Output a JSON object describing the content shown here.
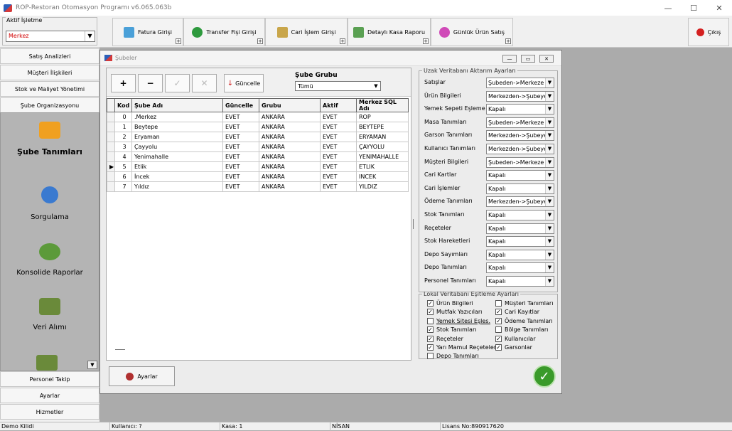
{
  "app": {
    "title": "ROP-Restoran Otomasyon Programı v6.065.063b"
  },
  "colors": {
    "selected_text": "#d00000",
    "accent_green": "#3a9a2a"
  },
  "business": {
    "label": "Aktif İşletme",
    "value": "Merkez"
  },
  "toolbar": [
    {
      "label": "Fatura Girişi",
      "icon": "invoice-icon"
    },
    {
      "label": "Transfer Fişi Girişi",
      "icon": "transfer-icon"
    },
    {
      "label": "Cari İşlem Girişi",
      "icon": "account-transaction-icon"
    },
    {
      "label": "Detaylı Kasa Raporu",
      "icon": "cash-report-icon"
    },
    {
      "label": "Günlük Ürün Satış",
      "icon": "daily-sales-icon"
    }
  ],
  "exit_label": "Çıkış",
  "nav": {
    "top": [
      "Satış Analizleri",
      "Müşteri İlişkileri",
      "Stok ve Maliyet Yönetimi",
      "Şube Organizasyonu"
    ],
    "panel": [
      {
        "label": "Şube Tanımları",
        "icon": "branch-icon"
      },
      {
        "label": "Sorgulama",
        "icon": "globe-query-icon"
      },
      {
        "label": "Konsolide Raporlar",
        "icon": "report-icon"
      },
      {
        "label": "Veri Alımı",
        "icon": "data-import-icon"
      }
    ],
    "bottom": [
      "Personel Takip",
      "Ayarlar",
      "Hizmetler"
    ]
  },
  "window": {
    "title": "Şubeler"
  },
  "grid_toolbar": {
    "update_label": "Güncelle",
    "group_label": "Şube Grubu",
    "group_value": "Tümü"
  },
  "grid": {
    "columns": [
      "",
      "Kod",
      "Şube Adı",
      "Güncelle",
      "Grubu",
      "Aktif",
      "Merkez SQL Adı"
    ],
    "rows": [
      [
        "",
        "0",
        ".Merkez",
        "EVET",
        "ANKARA",
        "EVET",
        "ROP"
      ],
      [
        "",
        "1",
        "Beytepe",
        "EVET",
        "ANKARA",
        "EVET",
        "BEYTEPE"
      ],
      [
        "",
        "2",
        "Eryaman",
        "EVET",
        "ANKARA",
        "EVET",
        "ERYAMAN"
      ],
      [
        "",
        "3",
        "Çayyolu",
        "EVET",
        "ANKARA",
        "EVET",
        "ÇAYYOLU"
      ],
      [
        "",
        "4",
        "Yenimahalle",
        "EVET",
        "ANKARA",
        "EVET",
        "YENIMAHALLE"
      ],
      [
        "▶",
        "5",
        "Etlik",
        "EVET",
        "ANKARA",
        "EVET",
        "ETLIK"
      ],
      [
        "",
        "6",
        "İncek",
        "EVET",
        "ANKARA",
        "EVET",
        "INCEK"
      ],
      [
        "",
        "7",
        "Yıldız",
        "EVET",
        "ANKARA",
        "EVET",
        "YILDIZ"
      ]
    ]
  },
  "remote": {
    "legend": "Uzak Veritabanı Aktarım Ayarları",
    "rows": [
      {
        "label": "Satışlar",
        "value": "Şubeden->Merkeze"
      },
      {
        "label": "Ürün Bilgileri",
        "value": "Merkezden->Şubeye"
      },
      {
        "label": "Yemek Sepeti Eşleme",
        "value": "Kapalı"
      },
      {
        "label": "Masa Tanımları",
        "value": "Şubeden->Merkeze"
      },
      {
        "label": "Garson Tanımları",
        "value": "Merkezden->Şubeye"
      },
      {
        "label": "Kullanıcı Tanımları",
        "value": "Merkezden->Şubeye"
      },
      {
        "label": "Müşteri Bilgileri",
        "value": "Şubeden->Merkeze"
      },
      {
        "label": "Cari Kartlar",
        "value": "Kapalı"
      },
      {
        "label": "Cari İşlemler",
        "value": "Kapalı"
      },
      {
        "label": "Ödeme Tanımları",
        "value": "Merkezden->Şubeye"
      },
      {
        "label": "Stok Tanımları",
        "value": "Kapalı"
      },
      {
        "label": "Reçeteler",
        "value": "Kapalı"
      },
      {
        "label": "Stok Hareketleri",
        "value": "Kapalı"
      },
      {
        "label": "Depo Sayımları",
        "value": "Kapalı"
      },
      {
        "label": "Depo Tanımları",
        "value": "Kapalı"
      },
      {
        "label": "Personel Tanımları",
        "value": "Kapalı"
      }
    ]
  },
  "local": {
    "legend": "Lokal Veritabanı Eşitleme Ayarları",
    "left": [
      {
        "label": "Ürün Bilgileri",
        "checked": true
      },
      {
        "label": "Mutfak Yazıcıları",
        "checked": true
      },
      {
        "label": "Yemek Sitesi Eşles.",
        "checked": false
      },
      {
        "label": "Stok Tanımları",
        "checked": true
      },
      {
        "label": "Reçeteler",
        "checked": true
      },
      {
        "label": "Yarı Mamul Reçeteler",
        "checked": true
      },
      {
        "label": "Depo Tanımları",
        "checked": false
      }
    ],
    "right": [
      {
        "label": "Müşteri Tanımları",
        "checked": false
      },
      {
        "label": "Cari Kayıtlar",
        "checked": true
      },
      {
        "label": "Ödeme Tanımları",
        "checked": true
      },
      {
        "label": "Bölge Tanımları",
        "checked": false
      },
      {
        "label": "Kullanıcılar",
        "checked": true
      },
      {
        "label": "Garsonlar",
        "checked": true
      }
    ]
  },
  "settings_label": "Ayarlar",
  "status": [
    "Demo Kilidi",
    "Kullanıcı: ?",
    "Kasa: 1",
    "NİSAN",
    "Lisans No:890917620"
  ]
}
